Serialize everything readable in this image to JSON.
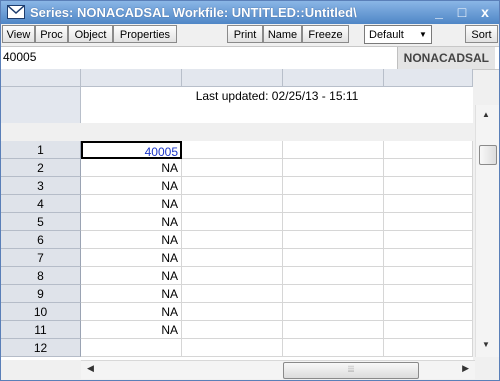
{
  "window": {
    "title": "Series: NONACADSAL   Workfile: UNTITLED::Untitled\\",
    "minimize_label": "_",
    "maximize_label": "□",
    "close_label": "x"
  },
  "toolbar": {
    "buttons": [
      "View",
      "Proc",
      "Object",
      "Properties",
      "Print",
      "Name",
      "Freeze",
      "Sort"
    ],
    "dropdown_value": "Default"
  },
  "infobar": {
    "cell_value": "40005",
    "series_name": "NONACADSAL"
  },
  "sheet": {
    "last_updated": "Last updated: 02/25/13 - 15:11",
    "rows": [
      {
        "index": "1",
        "value": "40005"
      },
      {
        "index": "2",
        "value": "NA"
      },
      {
        "index": "3",
        "value": "NA"
      },
      {
        "index": "4",
        "value": "NA"
      },
      {
        "index": "5",
        "value": "NA"
      },
      {
        "index": "6",
        "value": "NA"
      },
      {
        "index": "7",
        "value": "NA"
      },
      {
        "index": "8",
        "value": "NA"
      },
      {
        "index": "9",
        "value": "NA"
      },
      {
        "index": "10",
        "value": "NA"
      },
      {
        "index": "11",
        "value": "NA"
      },
      {
        "index": "12",
        "value": ""
      }
    ]
  },
  "icons": {
    "window_icon": "series-envelope-icon",
    "scroll_up": "arrow-up-icon",
    "scroll_down": "arrow-down-icon",
    "scroll_left": "arrow-left-icon",
    "scroll_right": "arrow-right-icon",
    "dropdown": "chevron-down-icon"
  },
  "colors": {
    "titlebar": "#4f86c6",
    "selected_value": "#1b36c8"
  }
}
